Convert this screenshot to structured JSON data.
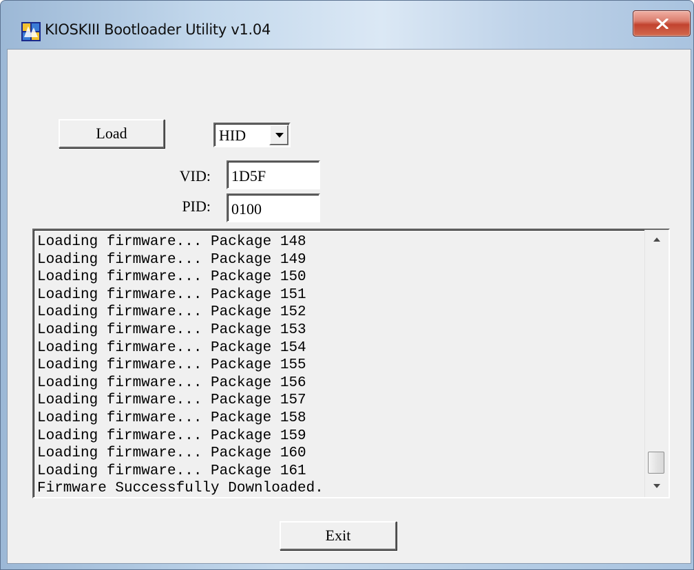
{
  "window": {
    "title": "KIOSKIII Bootloader Utility v1.04",
    "close_icon": "close-x-icon",
    "app_icon": "app-icon"
  },
  "controls": {
    "load_label": "Load",
    "interface_select": {
      "value": "HID",
      "icon": "chevron-down-icon"
    },
    "vid_label": "VID:",
    "vid_value": "1D5F",
    "pid_label": "PID:",
    "pid_value": "0100",
    "exit_label": "Exit"
  },
  "log": {
    "lines": [
      "Loading firmware... Package 148",
      "Loading firmware... Package 149",
      "Loading firmware... Package 150",
      "Loading firmware... Package 151",
      "Loading firmware... Package 152",
      "Loading firmware... Package 153",
      "Loading firmware... Package 154",
      "Loading firmware... Package 155",
      "Loading firmware... Package 156",
      "Loading firmware... Package 157",
      "Loading firmware... Package 158",
      "Loading firmware... Package 159",
      "Loading firmware... Package 160",
      "Loading firmware... Package 161",
      "Firmware Successfully Downloaded."
    ]
  },
  "colors": {
    "client_bg": "#f0f0f0",
    "close_button": "#c2432f",
    "titlebar": "#c3d8ec"
  }
}
